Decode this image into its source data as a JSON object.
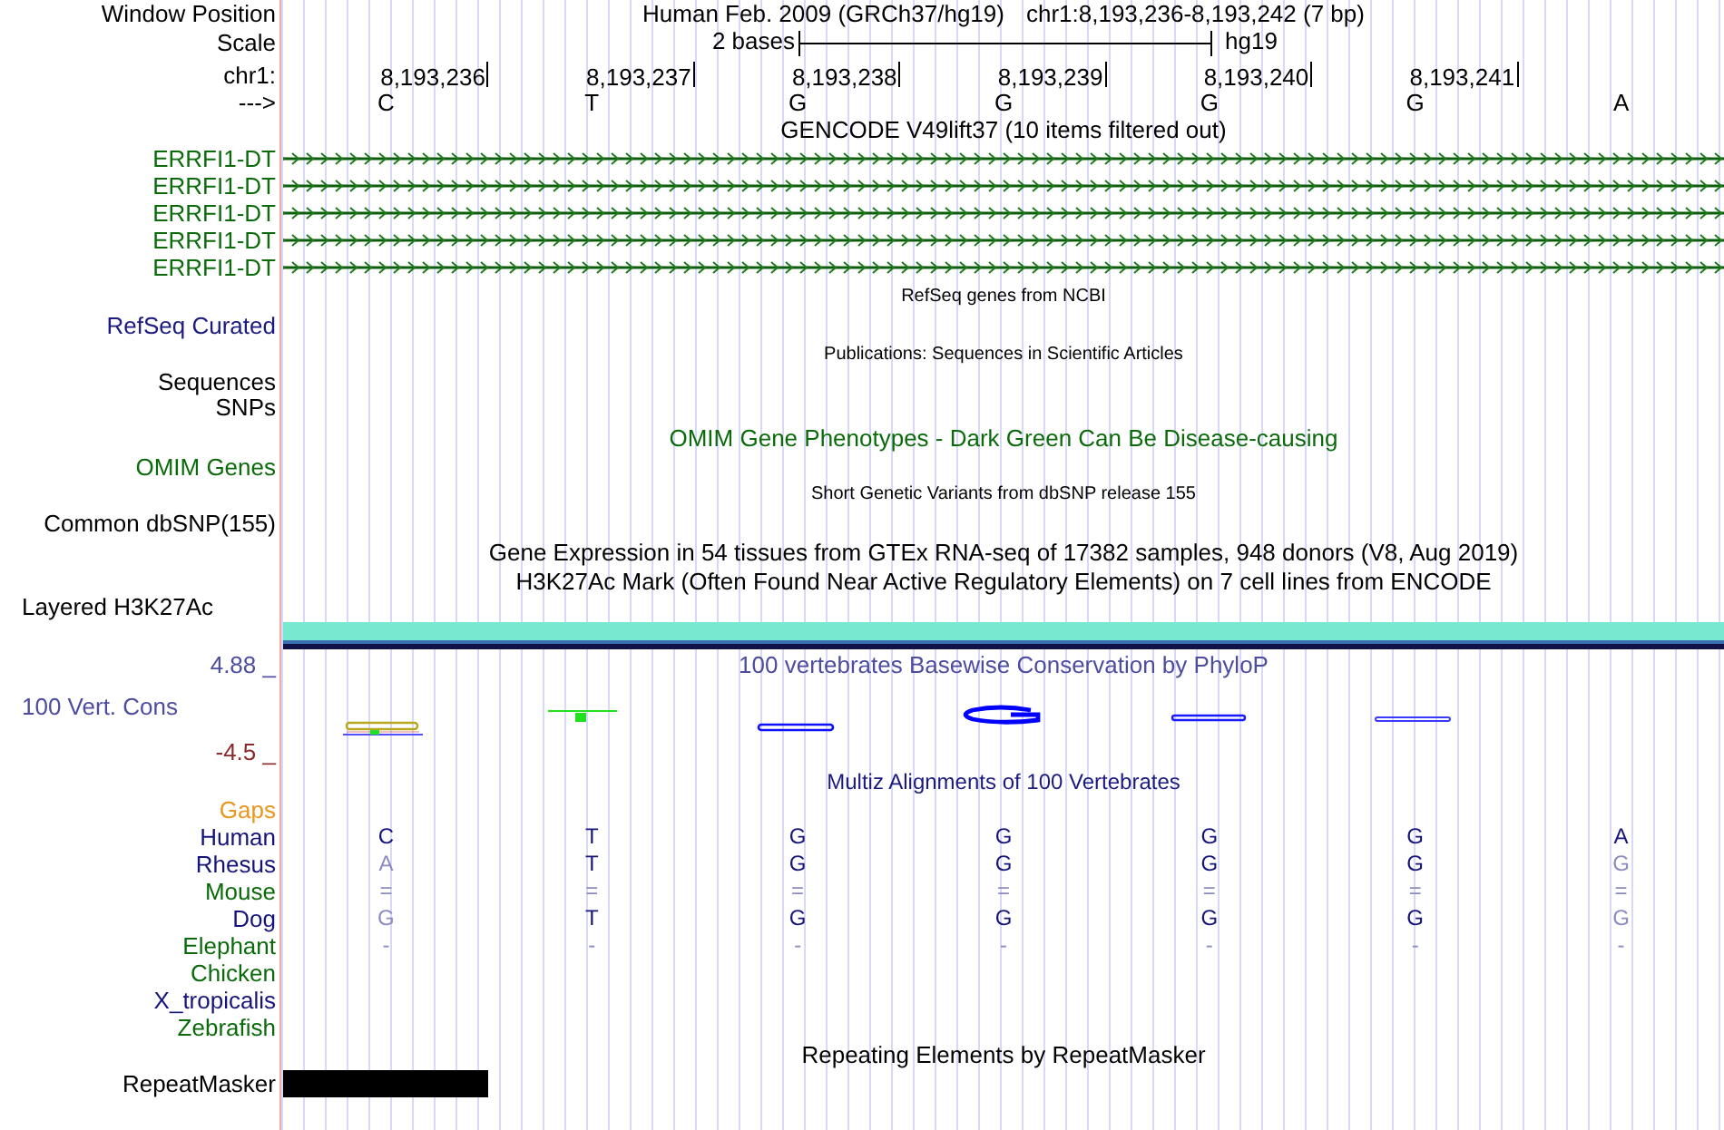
{
  "header": {
    "label": "Window Position",
    "assembly": "Human Feb. 2009 (GRCh37/hg19)",
    "position": "chr1:8,193,236-8,193,242 (7 bp)"
  },
  "scale": {
    "label": "Scale",
    "length": "2 bases",
    "assembly": "hg19"
  },
  "ruler": {
    "label": "chr1:",
    "ticks": [
      "8,193,236",
      "8,193,237",
      "8,193,238",
      "8,193,239",
      "8,193,240",
      "8,193,241"
    ]
  },
  "sequence": {
    "label": "--->",
    "bases": [
      "C",
      "T",
      "G",
      "G",
      "G",
      "G",
      "A"
    ]
  },
  "gencode": {
    "title": "GENCODE V49lift37 (10 items filtered out)",
    "transcripts": [
      "ERRFI1-DT",
      "ERRFI1-DT",
      "ERRFI1-DT",
      "ERRFI1-DT",
      "ERRFI1-DT"
    ]
  },
  "refseq": {
    "title": "RefSeq genes from NCBI",
    "label": "RefSeq Curated"
  },
  "publications": {
    "title": "Publications: Sequences in Scientific Articles",
    "labels": [
      "Sequences",
      "SNPs"
    ]
  },
  "omim": {
    "title": "OMIM Gene Phenotypes - Dark Green Can Be Disease-causing",
    "label": "OMIM Genes"
  },
  "dbsnp": {
    "title": "Short Genetic Variants from dbSNP release 155",
    "label": "Common dbSNP(155)"
  },
  "gtex": {
    "title": "Gene Expression in 54 tissues from GTEx RNA-seq of 17382 samples, 948 donors (V8, Aug 2019)"
  },
  "h3k27ac": {
    "title": "H3K27Ac Mark (Often Found Near Active Regulatory Elements) on 7 cell lines from ENCODE",
    "label": "Layered H3K27Ac"
  },
  "conservation": {
    "title": "100 vertebrates Basewise Conservation by PhyloP",
    "label": "100 Vert. Cons",
    "max": "4.88 _",
    "min": "-4.5 _"
  },
  "multiz": {
    "title": "Multiz Alignments of 100 Vertebrates",
    "gaps_label": "Gaps",
    "species": [
      {
        "name": "Human",
        "color": "#14147a",
        "bases": [
          {
            "base": "C",
            "dim": false
          },
          {
            "base": "T",
            "dim": false
          },
          {
            "base": "G",
            "dim": false
          },
          {
            "base": "G",
            "dim": false
          },
          {
            "base": "G",
            "dim": false
          },
          {
            "base": "G",
            "dim": false
          },
          {
            "base": "A",
            "dim": false
          }
        ]
      },
      {
        "name": "Rhesus",
        "color": "#14147a",
        "bases": [
          {
            "base": "A",
            "dim": true
          },
          {
            "base": "T",
            "dim": false
          },
          {
            "base": "G",
            "dim": false
          },
          {
            "base": "G",
            "dim": false
          },
          {
            "base": "G",
            "dim": false
          },
          {
            "base": "G",
            "dim": false
          },
          {
            "base": "G",
            "dim": true
          }
        ]
      },
      {
        "name": "Mouse",
        "color": "#0b6b0b",
        "bases": [
          {
            "base": "=",
            "dim": true
          },
          {
            "base": "=",
            "dim": true
          },
          {
            "base": "=",
            "dim": true
          },
          {
            "base": "=",
            "dim": true
          },
          {
            "base": "=",
            "dim": true
          },
          {
            "base": "=",
            "dim": true
          },
          {
            "base": "=",
            "dim": true
          }
        ]
      },
      {
        "name": "Dog",
        "color": "#14147a",
        "bases": [
          {
            "base": "G",
            "dim": true
          },
          {
            "base": "T",
            "dim": false
          },
          {
            "base": "G",
            "dim": false
          },
          {
            "base": "G",
            "dim": false
          },
          {
            "base": "G",
            "dim": false
          },
          {
            "base": "G",
            "dim": false
          },
          {
            "base": "G",
            "dim": true
          }
        ]
      },
      {
        "name": "Elephant",
        "color": "#0b6b0b",
        "bases": [
          {
            "base": "-",
            "dim": true
          },
          {
            "base": "-",
            "dim": true
          },
          {
            "base": "-",
            "dim": true
          },
          {
            "base": "-",
            "dim": true
          },
          {
            "base": "-",
            "dim": true
          },
          {
            "base": "-",
            "dim": true
          },
          {
            "base": "-",
            "dim": true
          }
        ]
      },
      {
        "name": "Chicken",
        "color": "#0b6b0b"
      },
      {
        "name": "X_tropicalis",
        "color": "#14147a"
      },
      {
        "name": "Zebrafish",
        "color": "#0b6b0b"
      }
    ]
  },
  "repeatmasker": {
    "title": "Repeating Elements by RepeatMasker",
    "label": "RepeatMasker"
  }
}
